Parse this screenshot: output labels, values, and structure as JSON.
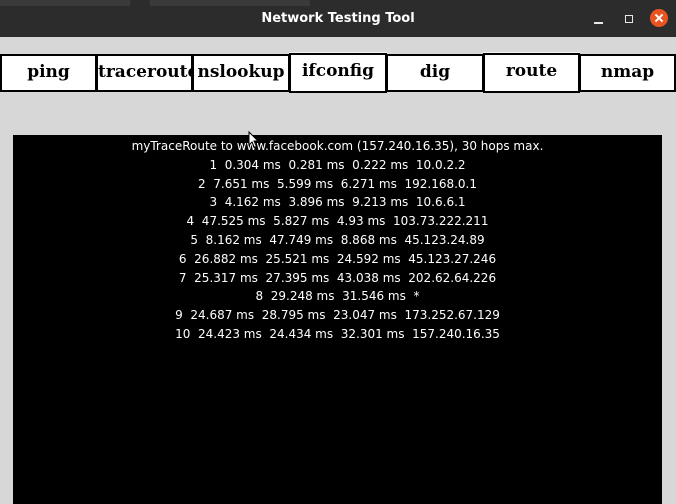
{
  "window": {
    "title": "Network Testing Tool",
    "controls": {
      "minimize": "–",
      "maximize": "□",
      "close": "✕"
    }
  },
  "tabs": [
    {
      "label": "ping"
    },
    {
      "label": "traceroute"
    },
    {
      "label": "nslookup"
    },
    {
      "label": "ifconfig"
    },
    {
      "label": "dig"
    },
    {
      "label": "route"
    },
    {
      "label": "nmap"
    }
  ],
  "output": {
    "header": "myTraceRoute to www.facebook.com (157.240.16.35), 30 hops max.",
    "lines": [
      "1  0.304 ms  0.281 ms  0.222 ms  10.0.2.2",
      "2  7.651 ms  5.599 ms  6.271 ms  192.168.0.1",
      "3  4.162 ms  3.896 ms  9.213 ms  10.6.6.1",
      "4  47.525 ms  5.827 ms  4.93 ms  103.73.222.211",
      "5  8.162 ms  47.749 ms  8.868 ms  45.123.24.89",
      "6  26.882 ms  25.521 ms  24.592 ms  45.123.27.246",
      "7  25.317 ms  27.395 ms  43.038 ms  202.62.64.226",
      "8  29.248 ms  31.546 ms  *",
      "9  24.687 ms  28.795 ms  23.047 ms  173.252.67.129",
      "10  24.423 ms  24.434 ms  32.301 ms  157.240.16.35"
    ]
  },
  "colors": {
    "titlebar": "#2c2c2c",
    "window_bg": "#d7d7d7",
    "output_bg": "#000000",
    "output_text": "#ffffff",
    "close_button": "#e95420"
  }
}
